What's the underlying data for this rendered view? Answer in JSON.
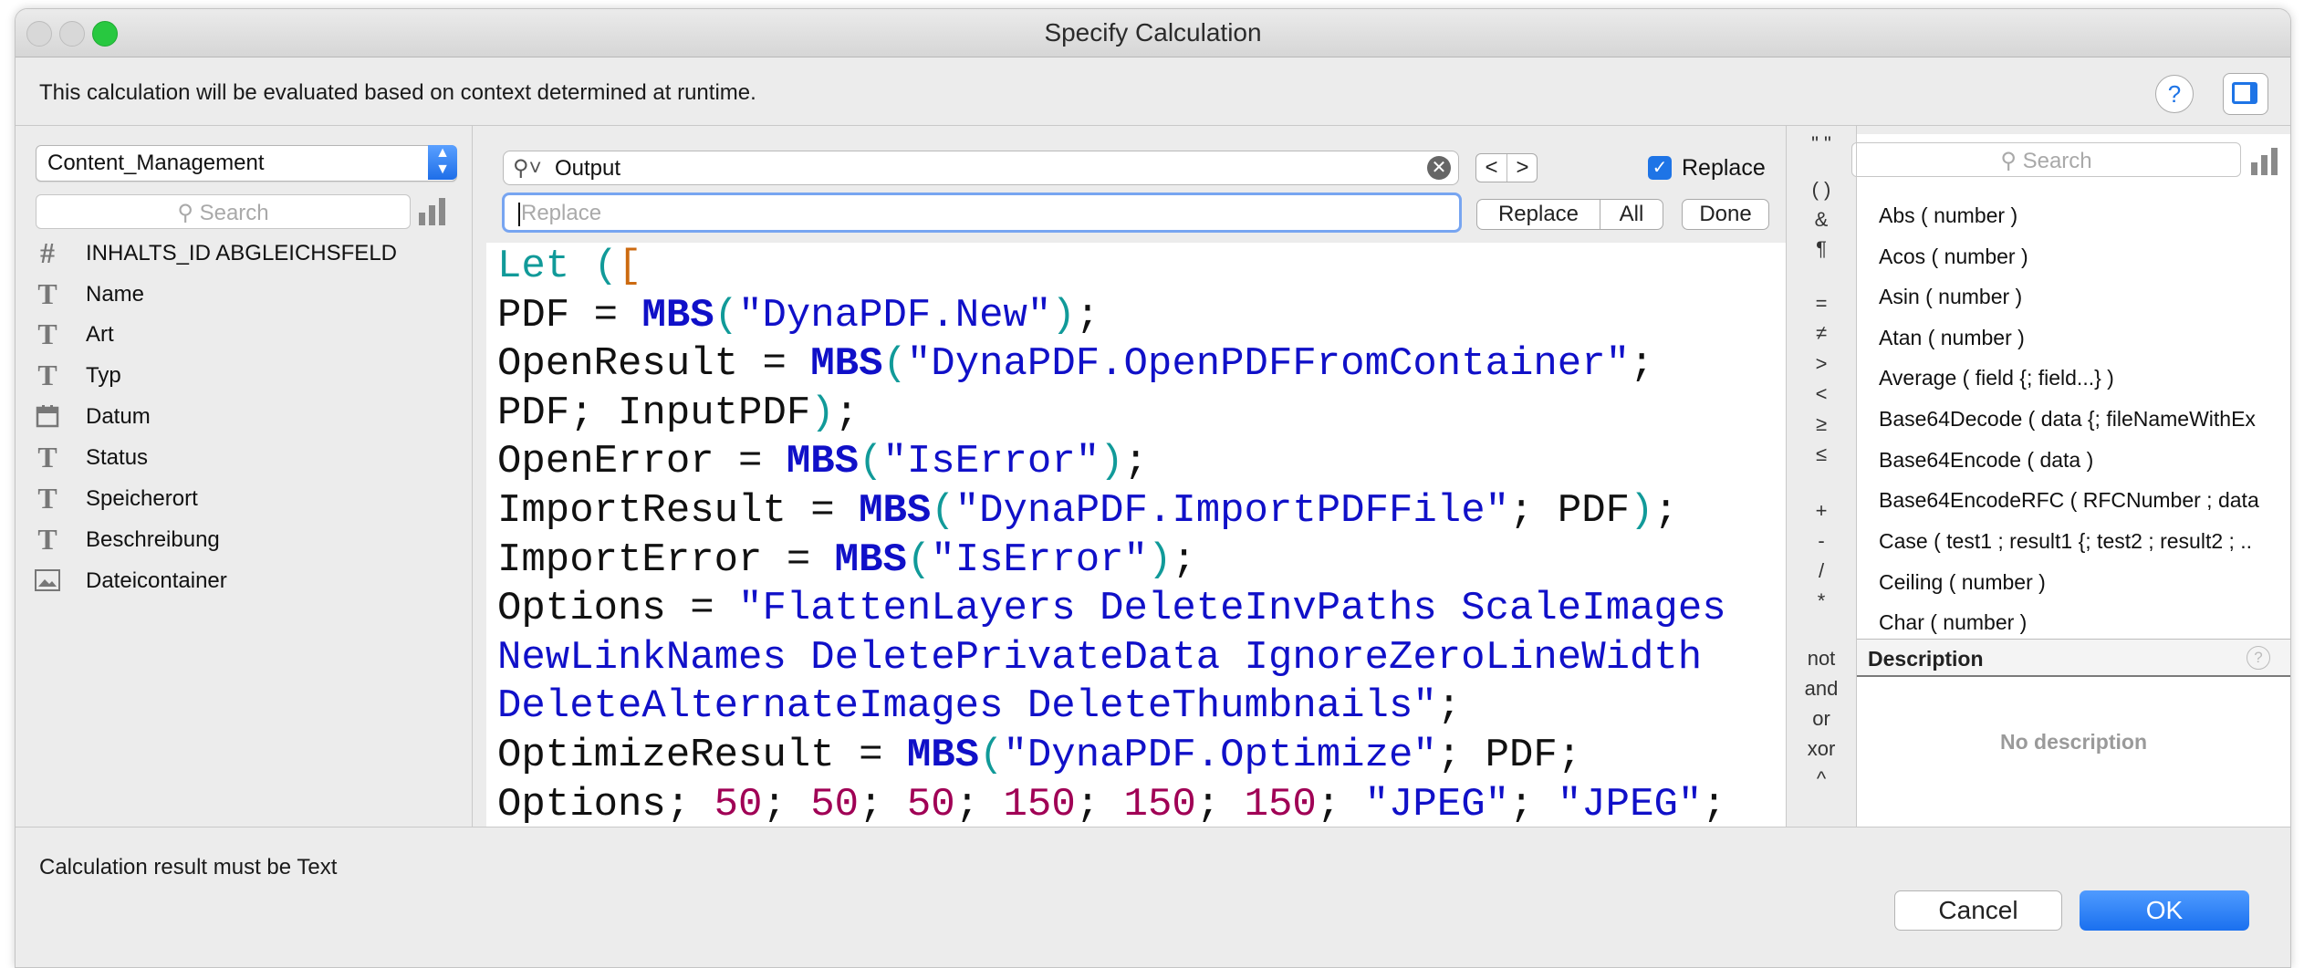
{
  "window": {
    "title": "Specify Calculation"
  },
  "context_hint": "This calculation will be evaluated based on context determined at runtime.",
  "help_label": "?",
  "left_panel": {
    "table": "Content_Management",
    "search_placeholder": "Search",
    "fields": [
      {
        "label": "INHALTS_ID ABGLEICHSFELD",
        "icon": "#"
      },
      {
        "label": "Name",
        "icon": "T"
      },
      {
        "label": "Art",
        "icon": "T"
      },
      {
        "label": "Typ",
        "icon": "T"
      },
      {
        "label": "Datum",
        "icon": "calendar"
      },
      {
        "label": "Status",
        "icon": "T"
      },
      {
        "label": "Speicherort",
        "icon": "T"
      },
      {
        "label": "Beschreibung",
        "icon": "T"
      },
      {
        "label": "Dateicontainer",
        "icon": "container"
      }
    ]
  },
  "find": {
    "query": "Output",
    "prev": "<",
    "next": ">",
    "replace_checkbox_label": "Replace",
    "replace_checked": true,
    "replace_placeholder": "Replace",
    "replace_button": "Replace",
    "all_button": "All",
    "done_button": "Done"
  },
  "operators": [
    "\" \"",
    "( )",
    "&",
    "¶",
    "=",
    "≠",
    ">",
    "<",
    "≥",
    "≤",
    "+",
    "-",
    "/",
    "*",
    "not",
    "and",
    "or",
    "xor",
    "^"
  ],
  "right_panel": {
    "search_placeholder": "Search",
    "functions": [
      "Abs ( number )",
      "Acos ( number )",
      "Asin ( number )",
      "Atan ( number )",
      "Average ( field {; field...} )",
      "Base64Decode ( data {; fileNameWithEx",
      "Base64Encode ( data )",
      "Base64EncodeRFC ( RFCNumber ; data",
      "Case ( test1 ; result1 {; test2 ; result2 ; ..",
      "Ceiling ( number )",
      "Char ( number )"
    ],
    "description_header": "Description",
    "description_text": "No description"
  },
  "code": {
    "let_kw": "Let",
    "open_paren": "(",
    "open_bracket": "[",
    "l1": {
      "var": "PDF = ",
      "fn": "MBS",
      "arg": "\"DynaPDF.New\"",
      "tail": ";"
    },
    "l2": {
      "var": "OpenResult = ",
      "fn": "MBS",
      "arg": "\"DynaPDF.OpenPDFFromContainer\"",
      "tail": ";"
    },
    "l3": {
      "text": "PDF; InputPDF",
      "tail": ";"
    },
    "l4": {
      "var": "OpenError = ",
      "fn": "MBS",
      "arg": "\"IsError\"",
      "tail": ";"
    },
    "l5": {
      "var": "ImportResult = ",
      "fn": "MBS",
      "arg": "\"DynaPDF.ImportPDFFile\"",
      "mid": "; PDF",
      "tail": ";"
    },
    "l6": {
      "var": "ImportError = ",
      "fn": "MBS",
      "arg": "\"IsError\"",
      "tail": ";"
    },
    "l7": {
      "var": "Options = ",
      "str": "\"FlattenLayers DeleteInvPaths ScaleImages"
    },
    "l8": {
      "str": "NewLinkNames DeletePrivateData IgnoreZeroLineWidth"
    },
    "l9": {
      "str": "DeleteAlternateImages DeleteThumbnails\"",
      "tail": ";"
    },
    "l10": {
      "var": "OptimizeResult = ",
      "fn": "MBS",
      "arg": "\"DynaPDF.Optimize\"",
      "mid": "; PDF;"
    },
    "l11": {
      "lead": "Options; ",
      "n1": "50",
      "n2": "50",
      "n3": "50",
      "n4": "150",
      "n5": "150",
      "n6": "150",
      "s1": "\"JPEG\"",
      "s2": "\"JPEG\""
    }
  },
  "footer": {
    "result_label": "Calculation result must be  Text",
    "cancel": "Cancel",
    "ok": "OK"
  },
  "colors": {
    "accent": "#1e74e6",
    "keyword": "#119a99",
    "mbs_fn": "#1010c8",
    "number": "#a00055",
    "bracket": "#cc6a10"
  }
}
